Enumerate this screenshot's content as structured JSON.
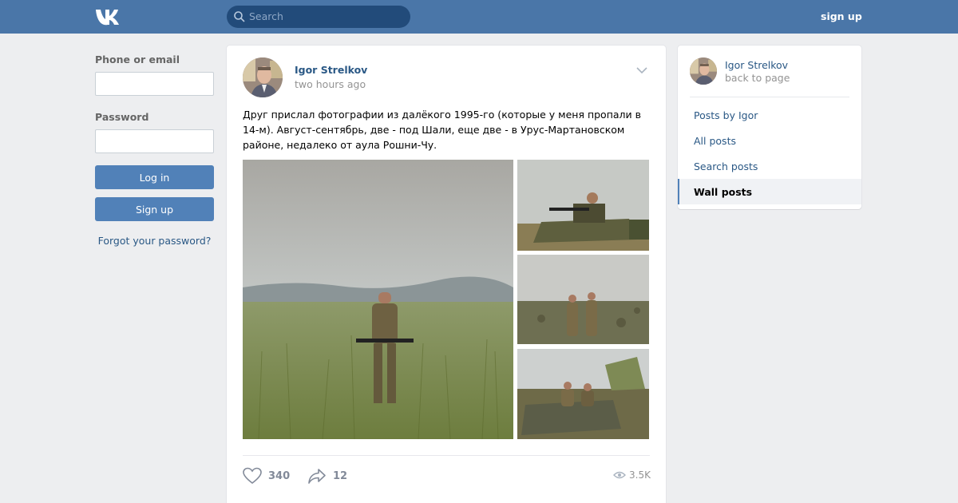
{
  "header": {
    "search_placeholder": "Search",
    "signup_label": "sign up"
  },
  "login": {
    "phone_label": "Phone or email",
    "password_label": "Password",
    "login_button": "Log in",
    "signup_button": "Sign up",
    "forgot_link": "Forgot your password?"
  },
  "post": {
    "author": "Igor Strelkov",
    "time": "two hours ago",
    "text": "Друг прислал фотографии из далёкого 1995-го (которые у меня пропали в 14-м). Август-сентябрь, две - под Шали, еще две - в Урус-Мартановском районе, недалеко от аула Рошни-Чу.",
    "likes": "340",
    "shares": "12",
    "views": "3.5K"
  },
  "sidebar": {
    "name": "Igor Strelkov",
    "back": "back to page",
    "items": [
      {
        "label": "Posts by Igor"
      },
      {
        "label": "All posts"
      },
      {
        "label": "Search posts"
      },
      {
        "label": "Wall posts"
      }
    ]
  },
  "colors": {
    "header": "#4a76a8",
    "button": "#5181b8",
    "link": "#2a5885"
  },
  "icons": {
    "logo": "vk-logo-icon",
    "search": "search-icon",
    "like": "heart-icon",
    "share": "share-arrow-icon",
    "views": "eye-icon",
    "menu": "chevron-down-icon"
  }
}
